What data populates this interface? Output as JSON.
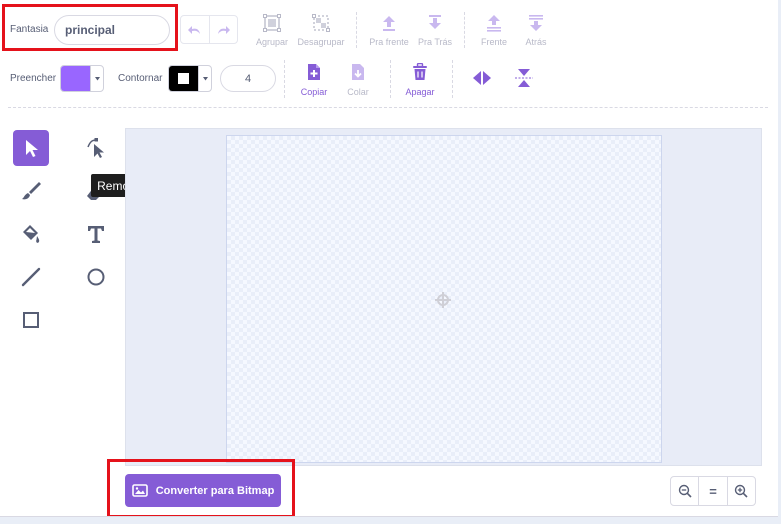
{
  "costume": {
    "label": "Fantasia",
    "name_value": "principal"
  },
  "toolbar_row1": {
    "group": "Agrupar",
    "ungroup": "Desagrupar",
    "forward": "Pra frente",
    "backward": "Pra Trás",
    "front": "Frente",
    "back": "Atrás"
  },
  "toolbar_row2": {
    "fill_label": "Preencher",
    "fill_color": "#9966ff",
    "outline_label": "Contornar",
    "outline_width": "4",
    "copy": "Copiar",
    "paste": "Colar",
    "delete": "Apagar"
  },
  "tooltip": {
    "text": "Remodelar"
  },
  "bottom": {
    "convert_button": "Converter para Bitmap",
    "zoom_reset": "="
  },
  "colors": {
    "accent": "#855cd6",
    "highlight": "#e5121b",
    "disabled": "#b8b9c8"
  }
}
